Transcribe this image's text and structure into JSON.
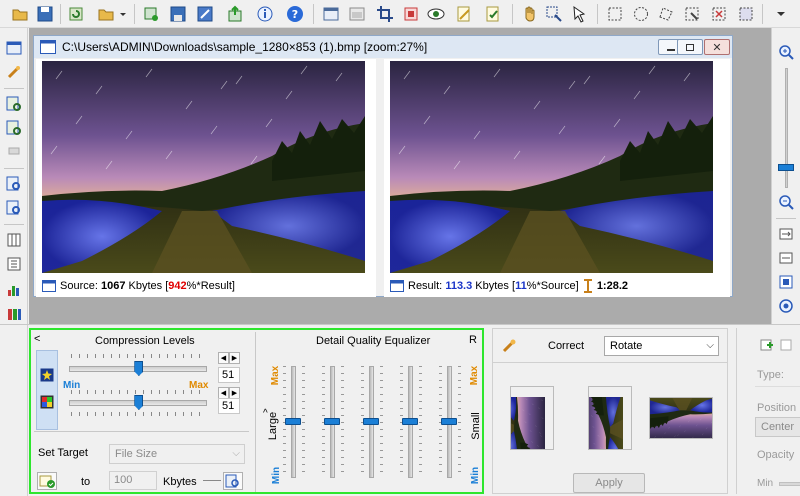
{
  "document": {
    "title": "C:\\Users\\ADMIN\\Downloads\\sample_1280×853 (1).bmp  [zoom:27%]",
    "source_status": {
      "label": "Source:",
      "size": "1067",
      "unit": "Kbytes",
      "open": "[",
      "percent": "942",
      "suffix": "%*Result]"
    },
    "result_status": {
      "label": "Result:",
      "size": "113.3",
      "unit": "Kbytes",
      "open": "[",
      "percent": "11",
      "suffix": "%*Source]",
      "ratio": "1:28.2"
    }
  },
  "compression": {
    "collapse": "<",
    "title": "Compression Levels",
    "min_label": "Min",
    "max_label": "Max",
    "level1": "51",
    "level2": "51",
    "level1_fraction": 0.51,
    "level2_fraction": 0.51,
    "set_target_label": "Set Target",
    "target_type": "File Size",
    "to_label": "to",
    "target_value": "100",
    "target_unit": "Kbytes"
  },
  "equalizer": {
    "title": "Detail Quality Equalizer",
    "reset": "R",
    "max_label": "Max",
    "min_label": "Min",
    "large_label": "Large",
    "small_label": "Small",
    "caret": "^",
    "band_levels": [
      0.5,
      0.5,
      0.5,
      0.5,
      0.5
    ]
  },
  "correct": {
    "label": "Correct",
    "mode": "Rotate",
    "apply": "Apply"
  },
  "watermark": {
    "type_label": "Type:",
    "position_label": "Position",
    "position_value": "Center",
    "opacity_label": "Opacity",
    "min_label": "Min"
  },
  "colors": {
    "accent": "#1b7fd6",
    "percent_red": "#e00000",
    "result_blue": "#1a35c8",
    "min_max_orange": "#e08a00",
    "min_blue": "#1b7fd6",
    "highlight_green": "#2ee62e"
  }
}
